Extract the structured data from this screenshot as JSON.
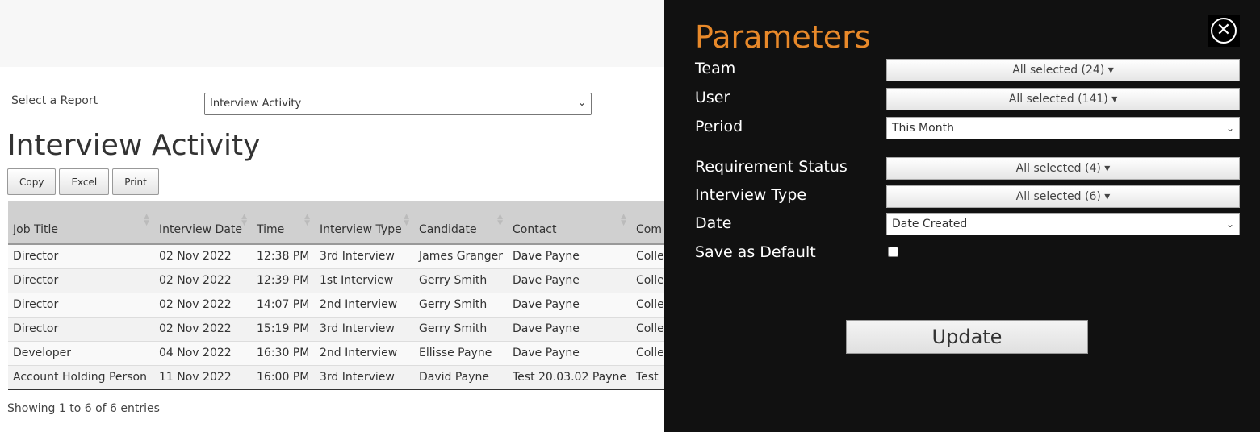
{
  "report_selector": {
    "label": "Select a Report",
    "value": "Interview Activity"
  },
  "page_title": "Interview Activity",
  "toolbar": {
    "copy": "Copy",
    "excel": "Excel",
    "print": "Print"
  },
  "table": {
    "headers": [
      "Job Title",
      "Interview Date",
      "Time",
      "Interview Type",
      "Candidate",
      "Contact",
      "Com"
    ],
    "rows": [
      [
        "Director",
        "02 Nov 2022",
        "12:38 PM",
        "3rd Interview",
        "James Granger",
        "Dave Payne",
        "Colle"
      ],
      [
        "Director",
        "02 Nov 2022",
        "12:39 PM",
        "1st Interview",
        "Gerry Smith",
        "Dave Payne",
        "Colle"
      ],
      [
        "Director",
        "02 Nov 2022",
        "14:07 PM",
        "2nd Interview",
        "Gerry Smith",
        "Dave Payne",
        "Colle"
      ],
      [
        "Director",
        "02 Nov 2022",
        "15:19 PM",
        "3rd Interview",
        "Gerry Smith",
        "Dave Payne",
        "Colle"
      ],
      [
        "Developer",
        "04 Nov 2022",
        "16:30 PM",
        "2nd Interview",
        "Ellisse Payne",
        "Dave Payne",
        "Colle"
      ],
      [
        "Account Holding Person",
        "11 Nov 2022",
        "16:00 PM",
        "3rd Interview",
        "David Payne",
        "Test 20.03.02 Payne",
        "Test"
      ]
    ]
  },
  "info": "Showing 1 to 6 of 6 entries",
  "panel": {
    "title": "Parameters",
    "accent": "#e8892a",
    "team": {
      "label": "Team",
      "value": "All selected (24)"
    },
    "user": {
      "label": "User",
      "value": "All selected (141)"
    },
    "period": {
      "label": "Period",
      "value": "This Month"
    },
    "req_status": {
      "label": "Requirement Status",
      "value": "All selected (4)"
    },
    "interview_type": {
      "label": "Interview Type",
      "value": "All selected (6)"
    },
    "date": {
      "label": "Date",
      "value": "Date Created"
    },
    "save_default": {
      "label": "Save as Default",
      "checked": false
    },
    "update": "Update"
  }
}
